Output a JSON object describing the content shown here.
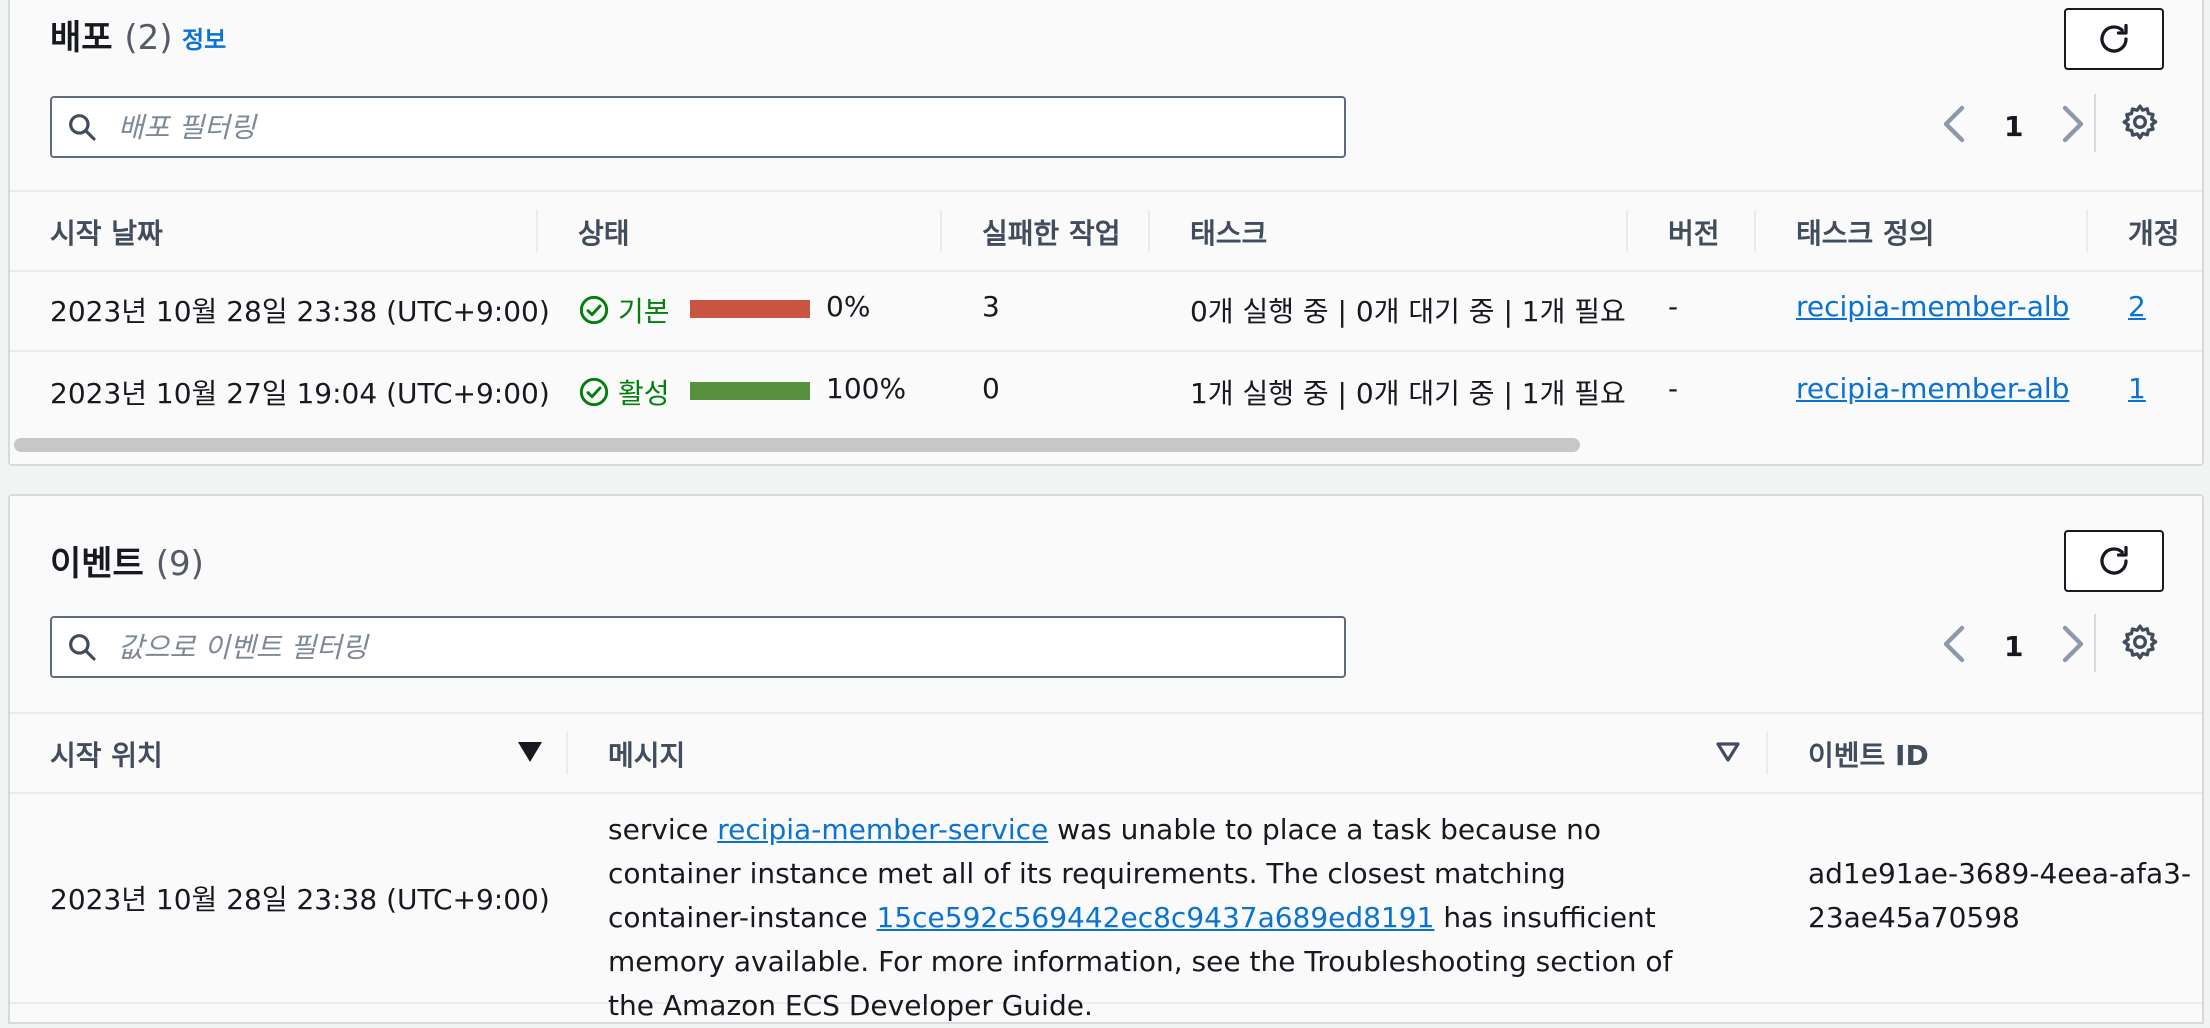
{
  "deployments": {
    "title": "배포",
    "count": "(2)",
    "info_link": "정보",
    "search_placeholder": "배포 필터링",
    "page": "1",
    "columns": {
      "start_date": "시작 날짜",
      "status": "상태",
      "failed_tasks": "실패한 작업",
      "tasks": "태스크",
      "version": "버전",
      "task_definition": "태스크 정의",
      "revision": "개정"
    },
    "rows": [
      {
        "start_date": "2023년 10월 28일 23:38 (UTC+9:00)",
        "status": "기본",
        "progress_label": "0%",
        "progress": 0,
        "failed": "3",
        "tasks": "0개 실행 중 | 0개 대기 중 | 1개 필요",
        "version": "-",
        "task_definition": "recipia-member-alb",
        "revision": "2"
      },
      {
        "start_date": "2023년 10월 27일 19:04 (UTC+9:00)",
        "status": "활성",
        "progress_label": "100%",
        "progress": 100,
        "failed": "0",
        "tasks": "1개 실행 중 | 0개 대기 중 | 1개 필요",
        "version": "-",
        "task_definition": "recipia-member-alb",
        "revision": "1"
      }
    ]
  },
  "events": {
    "title": "이벤트",
    "count": "(9)",
    "search_placeholder": "값으로 이벤트 필터링",
    "page": "1",
    "columns": {
      "start_time": "시작 위치",
      "message": "메시지",
      "event_id": "이벤트 ID"
    },
    "rows": [
      {
        "start_time": "2023년 10월 28일 23:38 (UTC+9:00)",
        "msg_pre": "service ",
        "msg_service_link": "recipia-member-service",
        "msg_mid": " was unable to place a task because no container instance met all of its requirements. The closest matching container-instance ",
        "msg_instance_link": "15ce592c569442ec8c9437a689ed8191",
        "msg_post": " has insufficient memory available. For more information, see the Troubleshooting section of the Amazon ECS Developer Guide.",
        "event_id": "ad1e91ae-3689-4eea-afa3-23ae45a70598"
      }
    ]
  },
  "colors": {
    "progress_failed": "#c9543f",
    "progress_success": "#58903e",
    "link": "#0972d3",
    "success_text": "#037f0c"
  },
  "icons": [
    "refresh-icon",
    "search-icon",
    "chevron-left-icon",
    "chevron-right-icon",
    "gear-icon",
    "check-circle-icon",
    "sort-desc-icon",
    "sort-icon"
  ]
}
